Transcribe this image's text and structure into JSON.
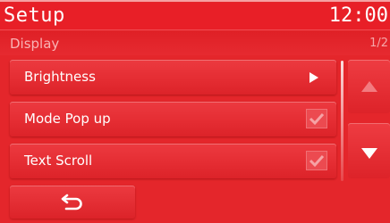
{
  "header": {
    "title": "Setup",
    "clock": "12:00"
  },
  "subheader": {
    "section": "Display",
    "page_indicator": "1/2"
  },
  "menu": {
    "items": [
      {
        "label": "Brightness",
        "control": "arrow-right-icon"
      },
      {
        "label": "Mode Pop up",
        "control": "checkbox",
        "checked": true
      },
      {
        "label": "Text Scroll",
        "control": "checkbox",
        "checked": true
      }
    ]
  },
  "scroll": {
    "up_icon": "triangle-up-icon",
    "down_icon": "triangle-down-icon",
    "up_enabled": false
  },
  "footer": {
    "back_icon": "back-arrow-icon"
  },
  "colors": {
    "background": "#e4262b",
    "text": "#ffffff",
    "dim_text": "#f9b3b4"
  }
}
